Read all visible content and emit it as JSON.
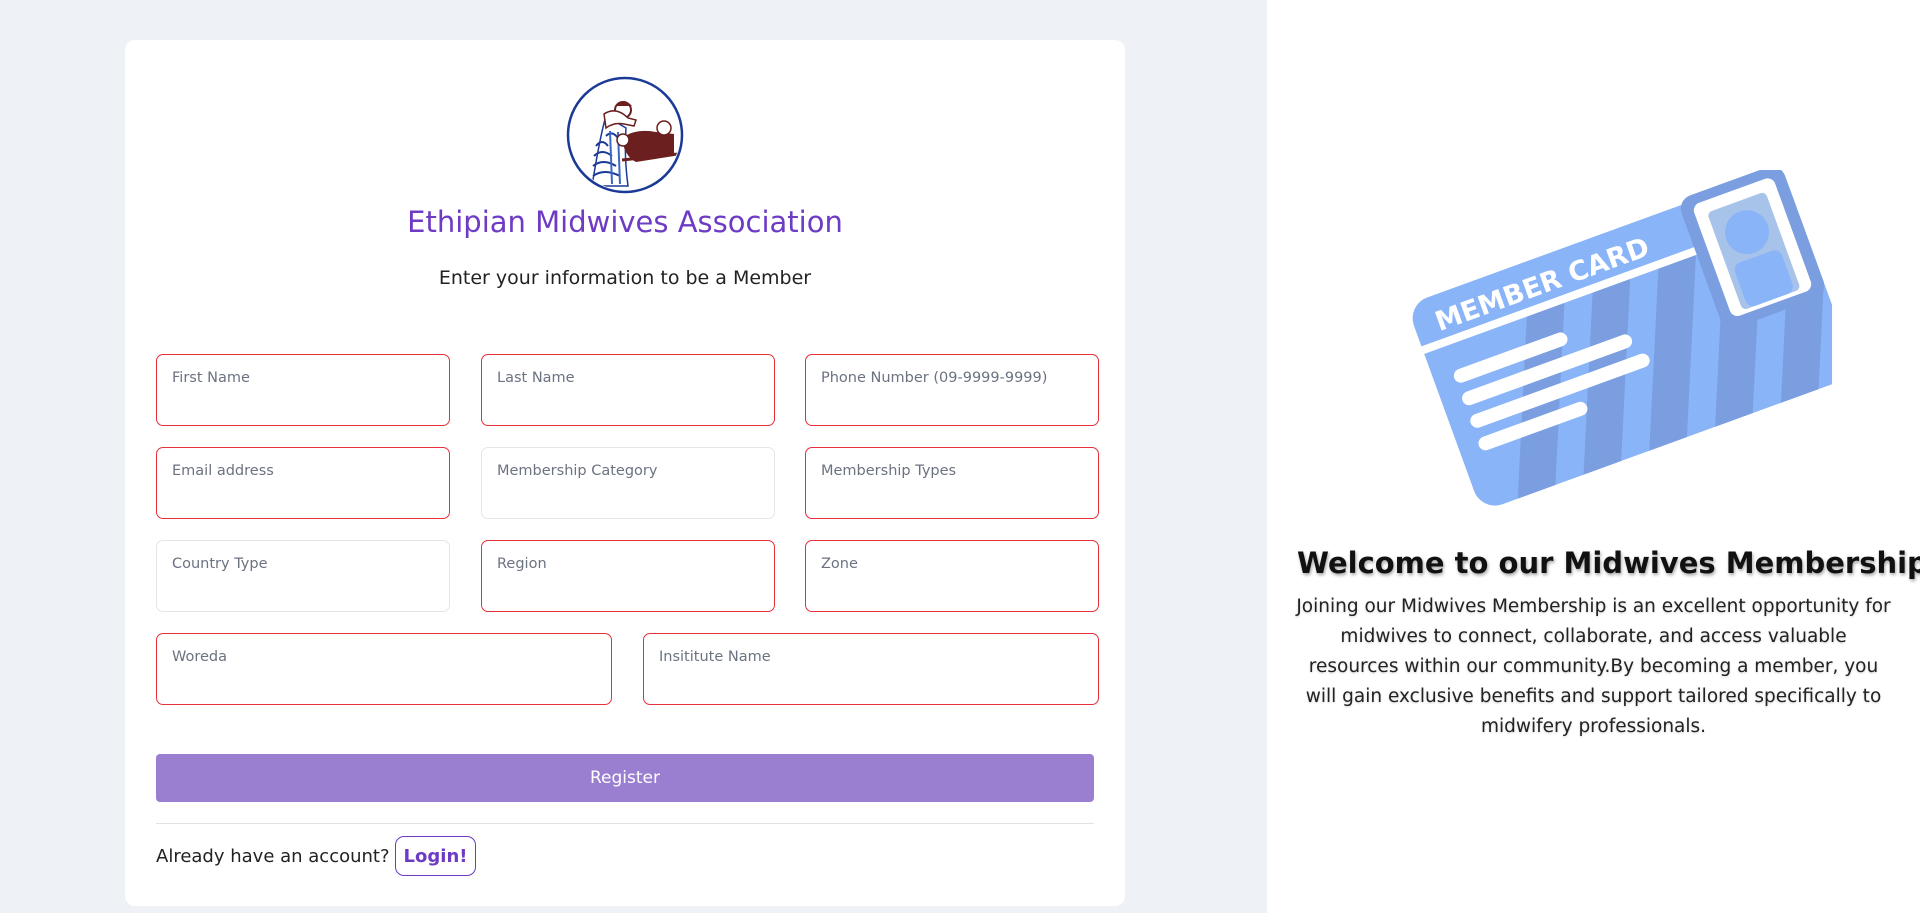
{
  "registration_form": {
    "org_name": "Ethipian Midwives Association",
    "subtitle": "Enter your information to be a Member",
    "fields": [
      {
        "label": "First Name",
        "value": ""
      },
      {
        "label": "Last Name",
        "value": ""
      },
      {
        "label": "Phone Number (09-9999-9999)",
        "value": ""
      },
      {
        "label": "Email address",
        "value": ""
      },
      {
        "label": "Membership Category",
        "value": ""
      },
      {
        "label": "Membership Types",
        "value": ""
      },
      {
        "label": "Country Type",
        "value": ""
      },
      {
        "label": "Region",
        "value": ""
      },
      {
        "label": "Zone",
        "value": ""
      },
      {
        "label": "Woreda",
        "value": ""
      },
      {
        "label": "Insititute Name",
        "value": ""
      }
    ],
    "register_label": "Register",
    "login_prompt": "Already have an account?",
    "login_label": "Login!",
    "colors": {
      "accent": "#6d3bc4",
      "button": "#9a7fd1",
      "invalid_border": "#e8303a"
    }
  },
  "welcome_panel": {
    "card_text": "MEMBER CARD",
    "title": "Welcome to our Midwives Membership!",
    "body": "Joining our Midwives Membership is an excellent opportunity for midwives to connect, collaborate, and access valuable resources within our community.By becoming a member, you will gain exclusive benefits and support tailored specifically to midwifery professionals."
  },
  "icons": {
    "logo": "midwives-association-logo",
    "card": "member-card-illustration"
  }
}
